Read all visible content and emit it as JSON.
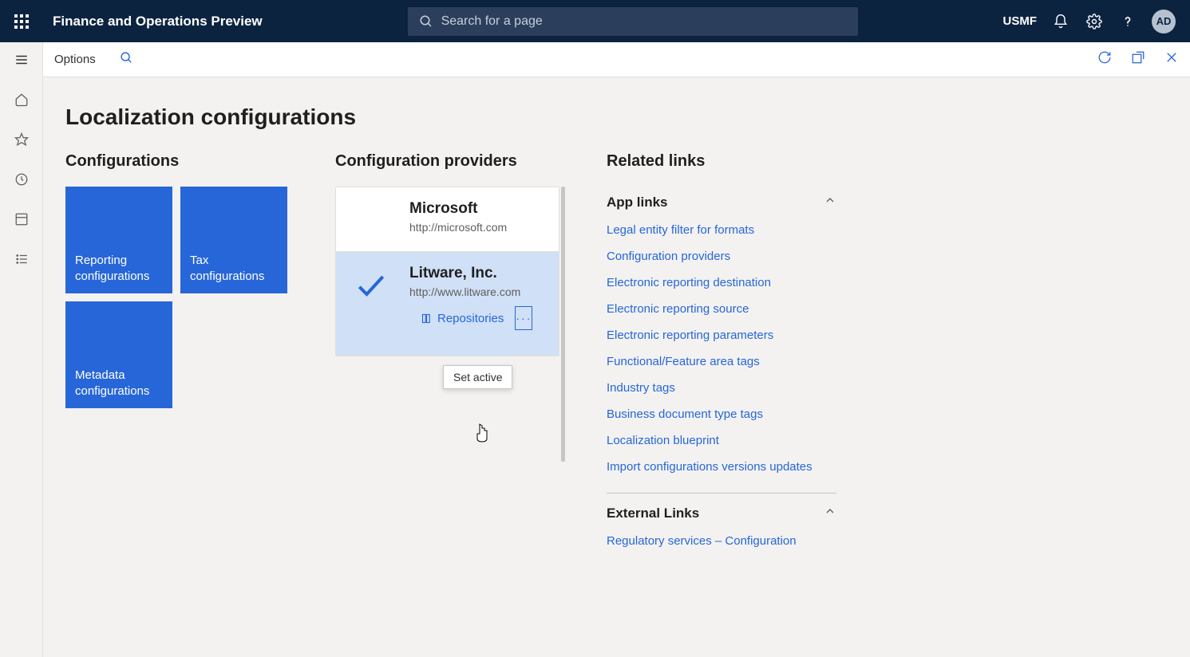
{
  "header": {
    "title": "Finance and Operations Preview",
    "search_placeholder": "Search for a page",
    "company": "USMF",
    "avatar": "AD"
  },
  "options_bar": {
    "label": "Options"
  },
  "rail": {
    "items": [
      "hamburger-icon",
      "home-icon",
      "star-icon",
      "clock-icon",
      "module-icon",
      "list-icon"
    ]
  },
  "page": {
    "title": "Localization configurations"
  },
  "configurations": {
    "heading": "Configurations",
    "tiles": [
      {
        "label": "Reporting configurations"
      },
      {
        "label": "Tax configurations"
      },
      {
        "label": "Metadata configurations"
      }
    ]
  },
  "providers": {
    "heading": "Configuration providers",
    "cards": [
      {
        "name": "Microsoft",
        "url": "http://microsoft.com",
        "active": false
      },
      {
        "name": "Litware, Inc.",
        "url": "http://www.litware.com",
        "active": true
      }
    ],
    "repositories_label": "Repositories",
    "menu_item": "Set active"
  },
  "related": {
    "heading": "Related links",
    "app_links_header": "App links",
    "app_links": [
      "Legal entity filter for formats",
      "Configuration providers",
      "Electronic reporting destination",
      "Electronic reporting source",
      "Electronic reporting parameters",
      "Functional/Feature area tags",
      "Industry tags",
      "Business document type tags",
      "Localization blueprint",
      "Import configurations versions updates"
    ],
    "external_header": "External Links",
    "external_links": [
      "Regulatory services – Configuration"
    ]
  }
}
